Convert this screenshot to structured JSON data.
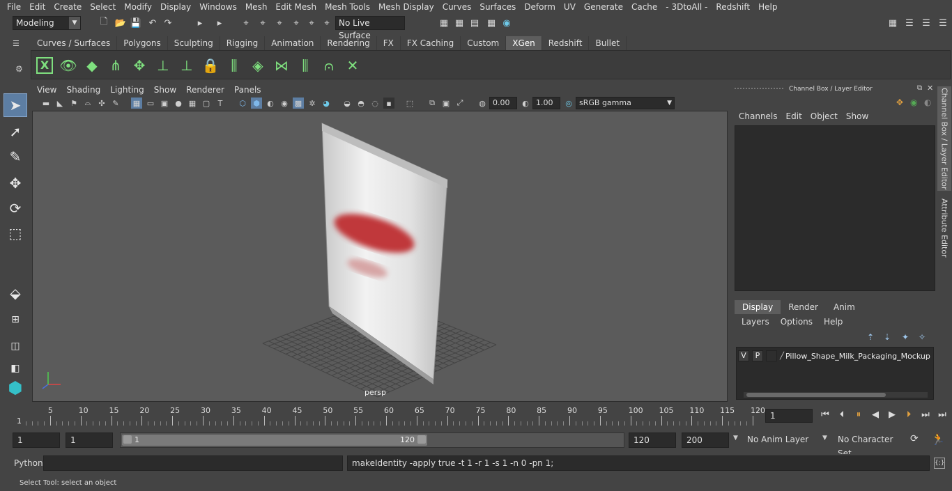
{
  "menubar": [
    "File",
    "Edit",
    "Create",
    "Select",
    "Modify",
    "Display",
    "Windows",
    "Mesh",
    "Edit Mesh",
    "Mesh Tools",
    "Mesh Display",
    "Curves",
    "Surfaces",
    "Deform",
    "UV",
    "Generate",
    "Cache",
    "- 3DtoAll -",
    "Redshift",
    "Help"
  ],
  "status": {
    "workspace": "Modeling",
    "live_surface": "No Live Surface"
  },
  "shelf": {
    "tabs": [
      "Curves / Surfaces",
      "Polygons",
      "Sculpting",
      "Rigging",
      "Animation",
      "Rendering",
      "FX",
      "FX Caching",
      "Custom",
      "XGen",
      "Redshift",
      "Bullet"
    ],
    "active_tab": "XGen"
  },
  "viewport": {
    "menus": [
      "View",
      "Shading",
      "Lighting",
      "Show",
      "Renderer",
      "Panels"
    ],
    "exposure": "0.00",
    "gamma": "1.00",
    "color_space": "sRGB gamma",
    "camera_label": "persp"
  },
  "channel_box": {
    "title": "Channel Box / Layer Editor",
    "menus": [
      "Channels",
      "Edit",
      "Object",
      "Show"
    ]
  },
  "layer_editor": {
    "tabs": [
      "Display",
      "Render",
      "Anim"
    ],
    "active_tab": "Display",
    "menus": [
      "Layers",
      "Options",
      "Help"
    ],
    "layer": {
      "v": "V",
      "p": "P",
      "name": "Pillow_Shape_Milk_Packaging_Mockup"
    }
  },
  "side_tabs": [
    "Channel Box / Layer Editor",
    "Attribute Editor"
  ],
  "timeline": {
    "ticks": [
      "5",
      "10",
      "15",
      "20",
      "25",
      "30",
      "35",
      "40",
      "45",
      "50",
      "55",
      "60",
      "65",
      "70",
      "75",
      "80",
      "85",
      "90",
      "95",
      "100",
      "105",
      "110",
      "115",
      "120"
    ],
    "start_marker": "1",
    "current_frame": "1"
  },
  "range": {
    "start": "1",
    "playback_start": "1",
    "slider_start": "1",
    "slider_end": "120",
    "playback_end": "120",
    "end": "200",
    "anim_layer": "No Anim Layer",
    "character_set": "No Character Set"
  },
  "command": {
    "language": "Python",
    "result": "makeIdentity -apply true -t 1 -r 1 -s 1 -n 0 -pn 1;"
  },
  "help_line": "Select Tool: select an object",
  "colors": {
    "bg": "#444444",
    "field": "#2b2b2b",
    "viewport": "#5b5b5b",
    "accent": "#5d5d5d",
    "shelf_icon": "#7fe07f"
  }
}
